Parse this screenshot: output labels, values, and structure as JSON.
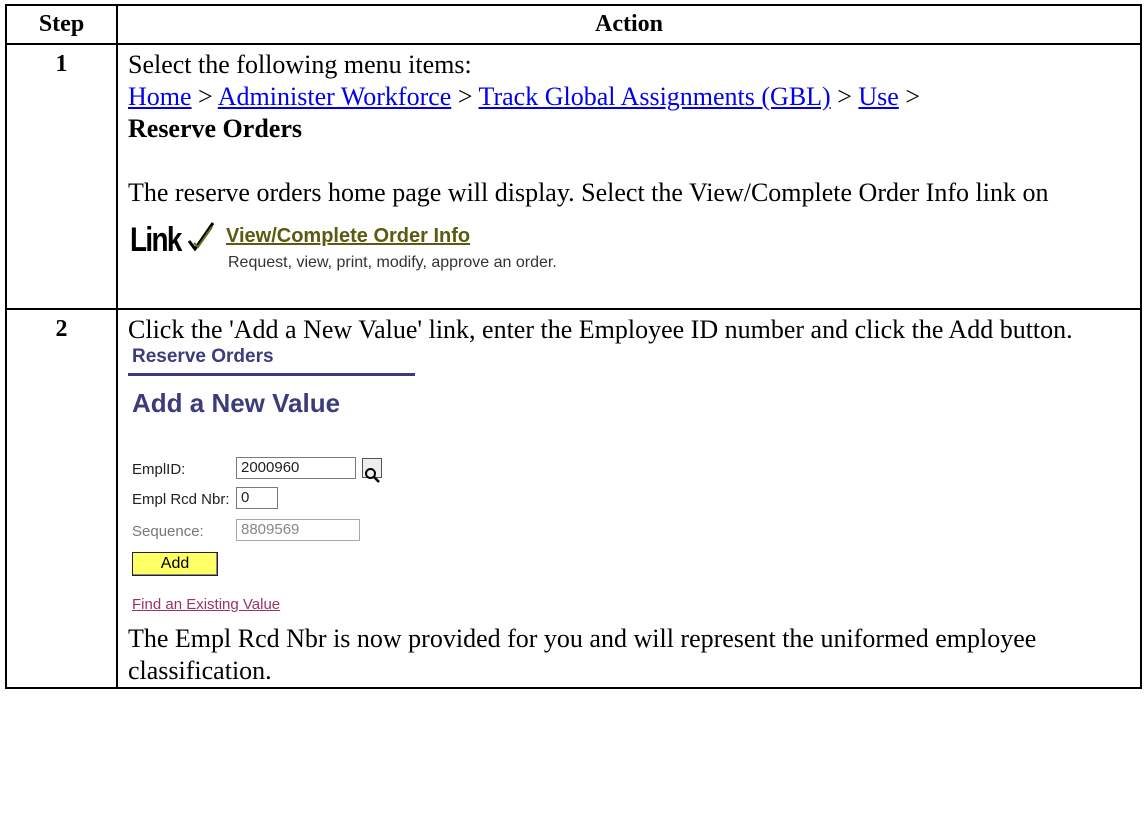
{
  "table": {
    "header_step": "Step",
    "header_action": "Action"
  },
  "step1": {
    "number": "1",
    "intro": "Select the following menu items:",
    "path": [
      "Home",
      "Administer Workforce",
      "Track Global Assignments (GBL)",
      "Use"
    ],
    "separator": " > ",
    "final_item": "Reserve Orders",
    "paragraph": "The reserve orders home page will display.  Select the View/Complete Order Info link on",
    "link_image": {
      "logo_text": "Link",
      "link_text": "View/Complete Order Info",
      "description": "Request, view, print, modify, approve an order."
    }
  },
  "step2": {
    "number": "2",
    "instruction": "Click the 'Add a New Value' link, enter the Employee ID number and click the Add button.",
    "screenshot": {
      "page_title": "Reserve Orders",
      "heading": "Add a New Value",
      "emplid_label": "EmplID:",
      "emplid_value": "2000960",
      "emplrcd_label": "Empl Rcd Nbr:",
      "emplrcd_value": "0",
      "sequence_label": "Sequence:",
      "sequence_value": "8809569",
      "add_button": "Add",
      "find_link": "Find an Existing Value"
    },
    "note": "The Empl Rcd Nbr is now provided for you and will represent the uniformed employee classification."
  }
}
